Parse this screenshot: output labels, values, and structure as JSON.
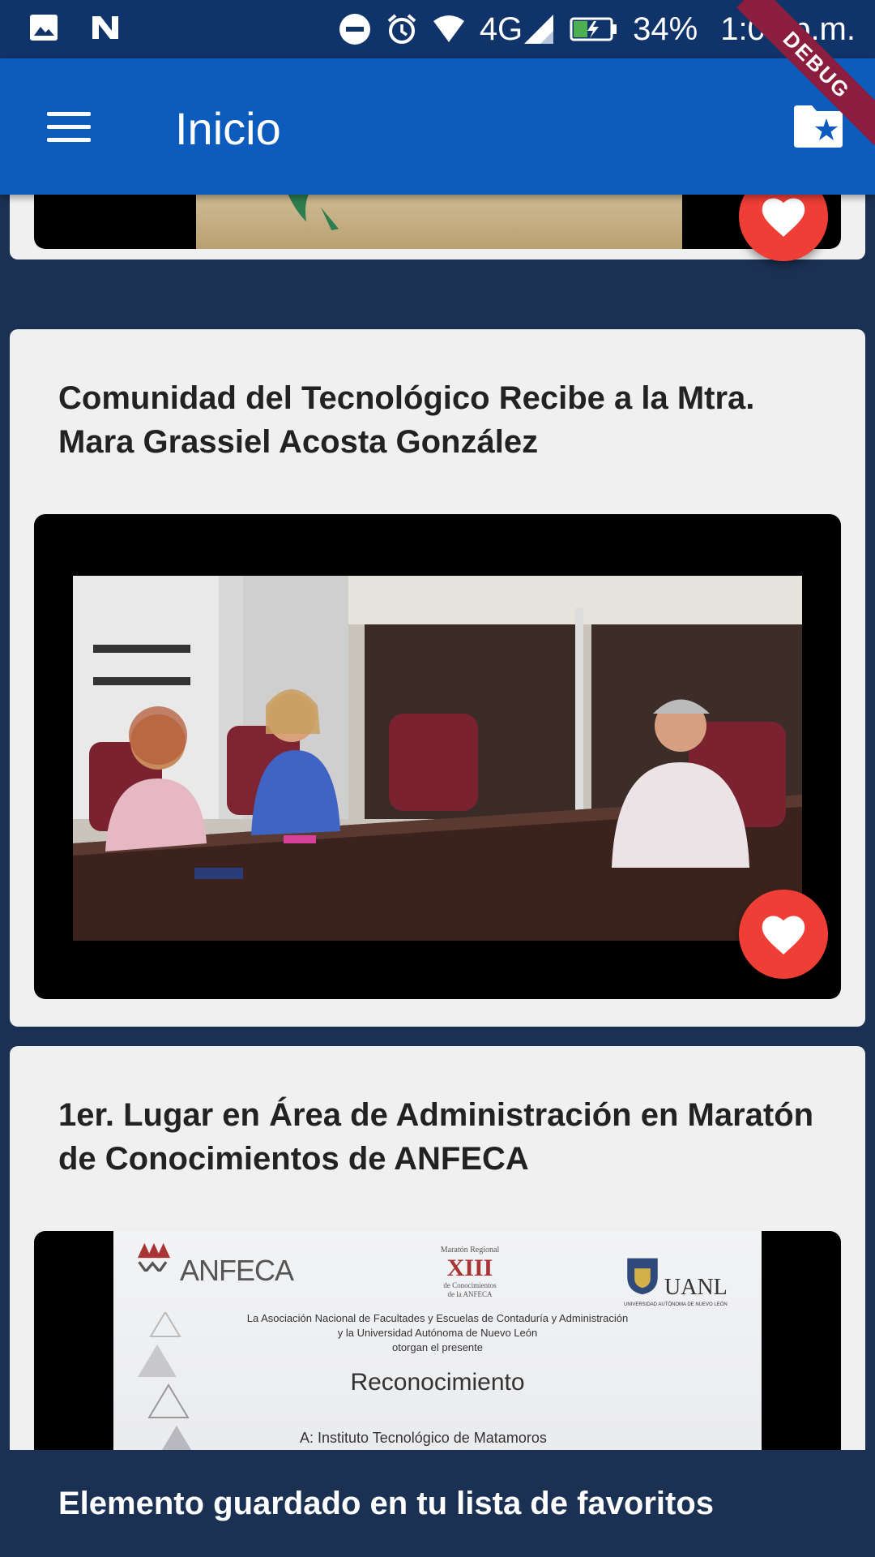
{
  "status_bar": {
    "network": "4G",
    "battery": "34%",
    "time": "1:08 p.m.",
    "debug_label": "DEBUG",
    "icons": [
      "gallery-icon",
      "n-app-icon",
      "dnd-icon",
      "alarm-icon",
      "wifi-icon",
      "signal-icon",
      "battery-charging-icon"
    ]
  },
  "app_bar": {
    "title": "Inicio",
    "menu_icon": "hamburger-menu-icon",
    "favorites_icon": "star-folder-icon",
    "color": "#0d5bbd"
  },
  "news": [
    {
      "title": "",
      "image": "green-leaf-on-paper"
    },
    {
      "title": "Comunidad del Tecnológico Recibe a la Mtra. Mara Grassiel Acosta González",
      "image": "meeting-at-table"
    },
    {
      "title": "1er. Lugar en Área de Administración en Maratón de Conocimientos de ANFECA",
      "image": "certificate-photo",
      "certificate": {
        "org_logo": "ANFECA",
        "event_line1": "Maratón Regional",
        "event_roman": "XIII",
        "event_line2": "de Conocimientos",
        "event_line3": "de la ANFECA",
        "university": "UANL",
        "university_sub": "UNIVERSIDAD AUTÓNOMA DE NUEVO LEÓN",
        "body_line1": "La Asociación Nacional de Facultades y Escuelas de Contaduría y Administración",
        "body_line2": "y la Universidad Autónoma de Nuevo León",
        "body_line3": "otorgan el presente",
        "heading": "Reconocimiento",
        "recipient": "A: Instituto Tecnológico de Matamoros"
      }
    }
  ],
  "favorite_icon": "heart-icon",
  "snackbar": {
    "message": "Elemento guardado en tu lista de favoritos"
  }
}
